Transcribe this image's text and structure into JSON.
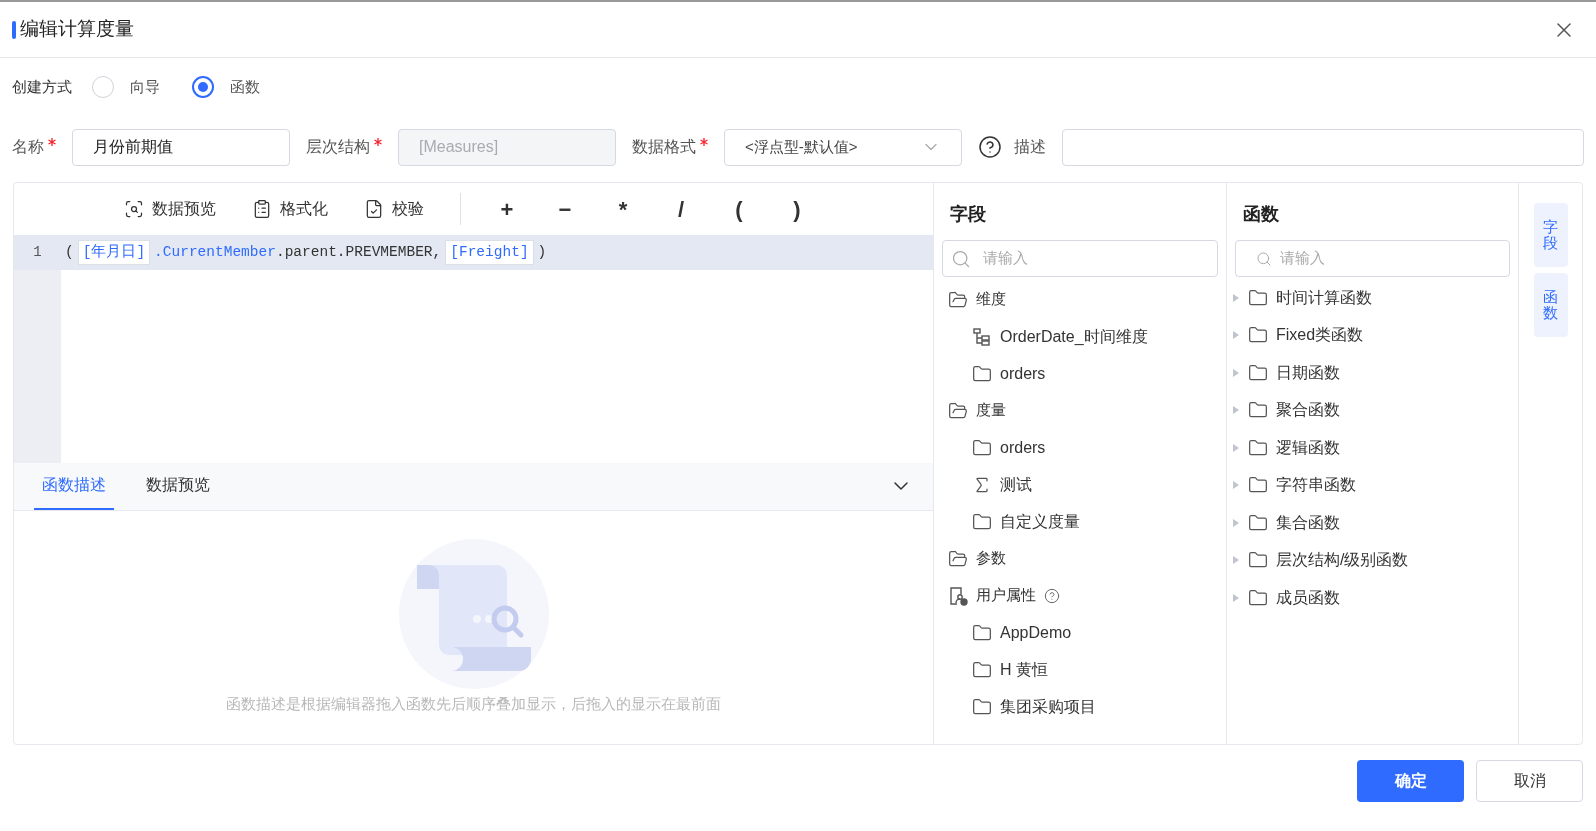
{
  "dialog": {
    "title": "编辑计算度量"
  },
  "creation_mode": {
    "label": "创建方式",
    "options": [
      {
        "label": "向导",
        "selected": false
      },
      {
        "label": "函数",
        "selected": true
      }
    ]
  },
  "form": {
    "name": {
      "label": "名称",
      "required": true,
      "value": "月份前期值"
    },
    "hierarchy": {
      "label": "层次结构",
      "required": true,
      "value": "[Measures]",
      "disabled": true
    },
    "format": {
      "label": "数据格式",
      "required": true,
      "value": "<浮点型-默认值>"
    },
    "description": {
      "label": "描述"
    }
  },
  "toolbar": {
    "actions": [
      {
        "label": "数据预览",
        "kind": "preview"
      },
      {
        "label": "格式化",
        "kind": "format"
      },
      {
        "label": "校验",
        "kind": "check"
      }
    ],
    "operators": [
      "+",
      "−",
      "*",
      "/",
      "(",
      ")"
    ]
  },
  "editor": {
    "lines": [
      {
        "number": "1",
        "tokens": [
          {
            "kind": "text",
            "text": "("
          },
          {
            "kind": "field",
            "text": "[年月日]"
          },
          {
            "kind": "keyword",
            "text": ".CurrentMember"
          },
          {
            "kind": "text",
            "text": ".parent.PREVMEMBER,"
          },
          {
            "kind": "field",
            "text": "[Freight]"
          },
          {
            "kind": "text",
            "text": ")"
          }
        ]
      }
    ]
  },
  "bottom_tabs": [
    {
      "label": "函数描述",
      "selected": true
    },
    {
      "label": "数据预览",
      "selected": false
    }
  ],
  "empty_text": "函数描述是根据编辑器拖入函数先后顺序叠加显示，后拖入的显示在最前面",
  "fields_panel": {
    "title": "字段",
    "search_placeholder": "请输入",
    "tree": [
      {
        "label": "维度",
        "kind": "group",
        "children": [
          {
            "label": "OrderDate_时间维度",
            "kind": "hierarchy"
          },
          {
            "label": "orders",
            "kind": "folder"
          }
        ]
      },
      {
        "label": "度量",
        "kind": "group",
        "children": [
          {
            "label": "orders",
            "kind": "folder"
          },
          {
            "label": "测试",
            "kind": "measure"
          },
          {
            "label": "自定义度量",
            "kind": "folder"
          }
        ]
      },
      {
        "label": "参数",
        "kind": "group"
      },
      {
        "label": "用户属性",
        "kind": "user",
        "help": true,
        "children": [
          {
            "label": "AppDemo",
            "kind": "folder"
          },
          {
            "label": "H 黄恒",
            "kind": "folder"
          },
          {
            "label": "集团采购项目",
            "kind": "folder"
          }
        ]
      }
    ]
  },
  "functions_panel": {
    "title": "函数",
    "search_placeholder": "请输入",
    "items": [
      {
        "label": "时间计算函数",
        "expanded": false
      },
      {
        "label": "Fixed类函数",
        "expanded": false
      },
      {
        "label": "日期函数",
        "expanded": false
      },
      {
        "label": "聚合函数",
        "expanded": false
      },
      {
        "label": "逻辑函数",
        "expanded": false
      },
      {
        "label": "字符串函数",
        "expanded": false
      },
      {
        "label": "集合函数",
        "expanded": false
      },
      {
        "label": "层次结构/级别函数",
        "expanded": false
      },
      {
        "label": "成员函数",
        "expanded": false
      }
    ]
  },
  "side_tabs": [
    {
      "label": "字段"
    },
    {
      "label": "函数"
    }
  ],
  "footer": {
    "buttons": [
      {
        "label": "确定",
        "kind": "primary"
      },
      {
        "label": "取消",
        "kind": "default"
      }
    ]
  }
}
